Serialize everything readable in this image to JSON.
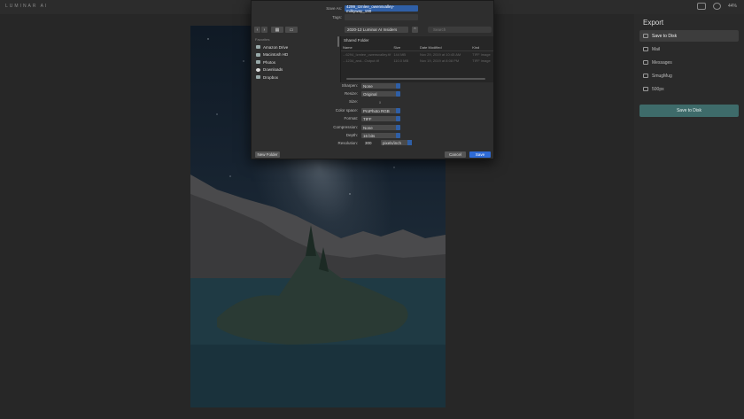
{
  "app": {
    "logo": "LUMINAR AI",
    "zoom": "44%"
  },
  "dialog": {
    "save_as_label": "Save As:",
    "save_as_value": "4299_Izmlee_owensvalley-milkyway_190",
    "tags_label": "Tags:",
    "folder": "2020-12 Luminar AI Insiders",
    "search_placeholder": "Search",
    "sidebar_heading": "Favorites",
    "sidebar_items": [
      "Amazon Drive",
      "Macintosh HD",
      "Photos",
      "Downloads",
      "Dropbox"
    ],
    "shared_folder": "Shared Folder",
    "columns": [
      "Name",
      "Size",
      "Date Modified",
      "Kind"
    ],
    "files": [
      {
        "name": "...6294_Izmlee_owensvalley.tif",
        "size": "144 MB",
        "date": "Nov 29, 2019 at 10:45 AM",
        "kind": "TIFF image"
      },
      {
        "name": "...1234_and...Output.tif",
        "size": "110.0 MB",
        "date": "Nov 19, 2019 at 8:08 PM",
        "kind": "TIFF image"
      }
    ],
    "options": [
      {
        "label": "Sharpen:",
        "value": "None"
      },
      {
        "label": "Resize:",
        "value": "Original"
      },
      {
        "label": "Size:",
        "value": ""
      },
      {
        "label": "Color space:",
        "value": "ProPhoto RGB"
      },
      {
        "label": "Format:",
        "value": "TIFF"
      },
      {
        "label": "Compression:",
        "value": "None"
      },
      {
        "label": "Depth:",
        "value": "16 bits"
      }
    ],
    "size_x": "x",
    "resolution_label": "Resolution:",
    "resolution_value": "300",
    "resolution_unit": "pixels/inch",
    "new_folder": "New Folder",
    "cancel": "Cancel",
    "save": "Save"
  },
  "export": {
    "title": "Export",
    "items": [
      {
        "label": "Save to Disk",
        "selected": true
      },
      {
        "label": "Mail",
        "selected": false
      },
      {
        "label": "Messages",
        "selected": false
      },
      {
        "label": "SmugMug",
        "selected": false
      },
      {
        "label": "500px",
        "selected": false
      }
    ],
    "button": "Save to Disk",
    "accent": "#3e6b6a"
  }
}
